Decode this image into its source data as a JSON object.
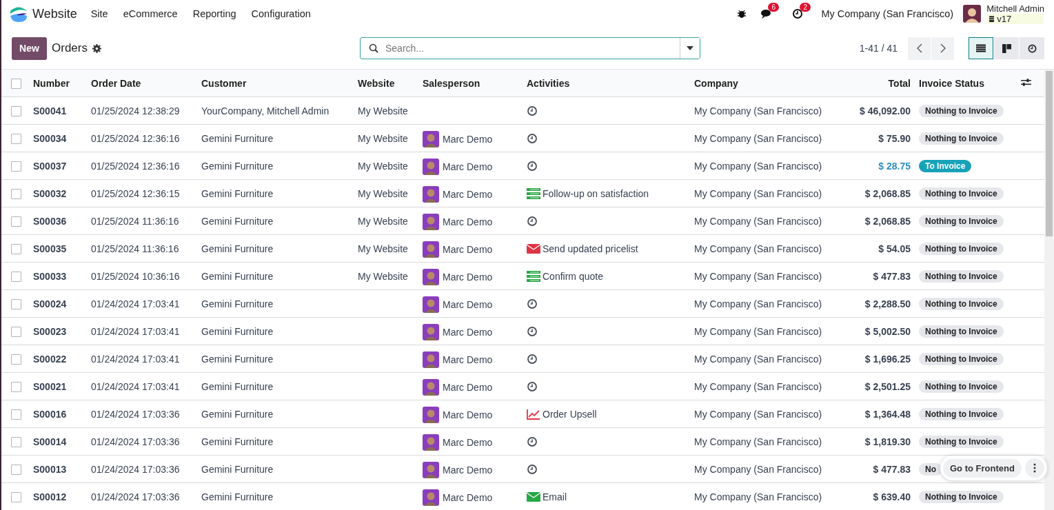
{
  "navbar": {
    "app_name": "Website",
    "menu": [
      "Site",
      "eCommerce",
      "Reporting",
      "Configuration"
    ],
    "messages_count": "6",
    "activities_count": "2",
    "company": "My Company (San Francisco)",
    "user_name": "Mitchell Admin",
    "database": "v17"
  },
  "control_panel": {
    "new_button": "New",
    "title": "Orders",
    "search": {
      "placeholder": "Search..."
    },
    "pager": "1-41 / 41",
    "views": [
      {
        "kind": "list",
        "selected": true
      },
      {
        "kind": "kanban",
        "selected": false
      },
      {
        "kind": "activity",
        "selected": false
      }
    ]
  },
  "table": {
    "all_selected": false,
    "columns": [
      "Number",
      "Order Date",
      "Customer",
      "Website",
      "Salesperson",
      "Activities",
      "Company",
      "Total",
      "Invoice Status"
    ],
    "rows": [
      {
        "number": "S00041",
        "date": "01/25/2024 12:38:29",
        "customer": "YourCompany, Mitchell Admin",
        "website": "My Website",
        "salesperson": "",
        "activity": {
          "kind": "clock"
        },
        "company": "My Company (San Francisco)",
        "total": "$ 46,092.00",
        "invoice": {
          "kind": "nothing",
          "label": "Nothing to Invoice"
        },
        "checked": false
      },
      {
        "number": "S00034",
        "date": "01/25/2024 12:36:16",
        "customer": "Gemini Furniture",
        "website": "My Website",
        "salesperson": "Marc Demo",
        "activity": {
          "kind": "clock"
        },
        "company": "My Company (San Francisco)",
        "total": "$ 75.90",
        "invoice": {
          "kind": "nothing",
          "label": "Nothing to Invoice"
        },
        "checked": false
      },
      {
        "number": "S00037",
        "date": "01/25/2024 12:36:16",
        "customer": "Gemini Furniture",
        "website": "My Website",
        "salesperson": "Marc Demo",
        "activity": {
          "kind": "clock"
        },
        "company": "My Company (San Francisco)",
        "total": "$ 28.75",
        "invoice": {
          "kind": "to_invoice",
          "label": "To Invoice"
        },
        "checked": false
      },
      {
        "number": "S00032",
        "date": "01/25/2024 12:36:15",
        "customer": "Gemini Furniture",
        "website": "My Website",
        "salesperson": "Marc Demo",
        "activity": {
          "kind": "todo",
          "color": "#28a745",
          "label": "Follow-up on satisfaction"
        },
        "company": "My Company (San Francisco)",
        "total": "$ 2,068.85",
        "invoice": {
          "kind": "nothing",
          "label": "Nothing to Invoice"
        },
        "checked": false
      },
      {
        "number": "S00036",
        "date": "01/25/2024 11:36:16",
        "customer": "Gemini Furniture",
        "website": "My Website",
        "salesperson": "Marc Demo",
        "activity": {
          "kind": "clock"
        },
        "company": "My Company (San Francisco)",
        "total": "$ 2,068.85",
        "invoice": {
          "kind": "nothing",
          "label": "Nothing to Invoice"
        },
        "checked": false
      },
      {
        "number": "S00035",
        "date": "01/25/2024 11:36:16",
        "customer": "Gemini Furniture",
        "website": "My Website",
        "salesperson": "Marc Demo",
        "activity": {
          "kind": "email",
          "color": "#dc3545",
          "label": "Send updated pricelist"
        },
        "company": "My Company (San Francisco)",
        "total": "$ 54.05",
        "invoice": {
          "kind": "nothing",
          "label": "Nothing to Invoice"
        },
        "checked": false
      },
      {
        "number": "S00033",
        "date": "01/25/2024 10:36:16",
        "customer": "Gemini Furniture",
        "website": "My Website",
        "salesperson": "Marc Demo",
        "activity": {
          "kind": "todo",
          "color": "#28a745",
          "label": "Confirm quote"
        },
        "company": "My Company (San Francisco)",
        "total": "$ 477.83",
        "invoice": {
          "kind": "nothing",
          "label": "Nothing to Invoice"
        },
        "checked": false
      },
      {
        "number": "S00024",
        "date": "01/24/2024 17:03:41",
        "customer": "Gemini Furniture",
        "website": "",
        "salesperson": "Marc Demo",
        "activity": {
          "kind": "clock"
        },
        "company": "My Company (San Francisco)",
        "total": "$ 2,288.50",
        "invoice": {
          "kind": "nothing",
          "label": "Nothing to Invoice"
        },
        "checked": false
      },
      {
        "number": "S00023",
        "date": "01/24/2024 17:03:41",
        "customer": "Gemini Furniture",
        "website": "",
        "salesperson": "Marc Demo",
        "activity": {
          "kind": "clock"
        },
        "company": "My Company (San Francisco)",
        "total": "$ 5,002.50",
        "invoice": {
          "kind": "nothing",
          "label": "Nothing to Invoice"
        },
        "checked": false
      },
      {
        "number": "S00022",
        "date": "01/24/2024 17:03:41",
        "customer": "Gemini Furniture",
        "website": "",
        "salesperson": "Marc Demo",
        "activity": {
          "kind": "clock"
        },
        "company": "My Company (San Francisco)",
        "total": "$ 1,696.25",
        "invoice": {
          "kind": "nothing",
          "label": "Nothing to Invoice"
        },
        "checked": false
      },
      {
        "number": "S00021",
        "date": "01/24/2024 17:03:41",
        "customer": "Gemini Furniture",
        "website": "",
        "salesperson": "Marc Demo",
        "activity": {
          "kind": "clock"
        },
        "company": "My Company (San Francisco)",
        "total": "$ 2,501.25",
        "invoice": {
          "kind": "nothing",
          "label": "Nothing to Invoice"
        },
        "checked": false
      },
      {
        "number": "S00016",
        "date": "01/24/2024 17:03:36",
        "customer": "Gemini Furniture",
        "website": "",
        "salesperson": "Marc Demo",
        "activity": {
          "kind": "upsell",
          "color": "#dc3545",
          "label": "Order Upsell"
        },
        "company": "My Company (San Francisco)",
        "total": "$ 1,364.48",
        "invoice": {
          "kind": "nothing",
          "label": "Nothing to Invoice"
        },
        "checked": false
      },
      {
        "number": "S00014",
        "date": "01/24/2024 17:03:36",
        "customer": "Gemini Furniture",
        "website": "",
        "salesperson": "Marc Demo",
        "activity": {
          "kind": "clock"
        },
        "company": "My Company (San Francisco)",
        "total": "$ 1,819.30",
        "invoice": {
          "kind": "nothing",
          "label": "Nothing to Invoice"
        },
        "checked": false
      },
      {
        "number": "S00013",
        "date": "01/24/2024 17:03:36",
        "customer": "Gemini Furniture",
        "website": "",
        "salesperson": "Marc Demo",
        "activity": {
          "kind": "clock"
        },
        "company": "My Company (San Francisco)",
        "total": "$ 477.83",
        "invoice": {
          "kind": "nothing",
          "label": "No"
        },
        "checked": false
      },
      {
        "number": "S00012",
        "date": "01/24/2024 17:03:36",
        "customer": "Gemini Furniture",
        "website": "",
        "salesperson": "Marc Demo",
        "activity": {
          "kind": "email",
          "color": "#28a745",
          "label": "Email"
        },
        "company": "My Company (San Francisco)",
        "total": "$ 639.40",
        "invoice": {
          "kind": "nothing",
          "label": "Nothing to Invoice"
        },
        "checked": false
      }
    ]
  },
  "floating": {
    "button": "Go to Frontend"
  }
}
